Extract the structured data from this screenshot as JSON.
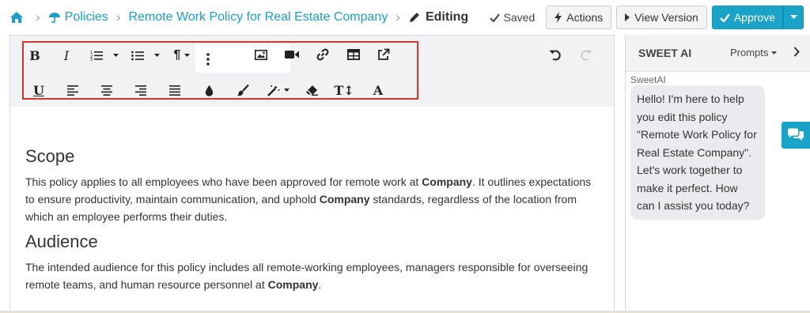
{
  "breadcrumb": {
    "home_icon": "home-icon",
    "policies_icon": "umbrella-icon",
    "policies_label": "Policies",
    "policy_title": "Remote Work Policy for Real Estate Company",
    "current_icon": "pencil-icon",
    "current_label": "Editing",
    "separator": "›"
  },
  "header": {
    "saved_label": "Saved",
    "actions_label": "Actions",
    "view_version_label": "View Version",
    "approve_label": "Approve"
  },
  "toolbar": {
    "buttons": [
      {
        "name": "bold",
        "label": "B"
      },
      {
        "name": "italic",
        "label": "I"
      },
      {
        "name": "ordered-list",
        "icon": "ordered-list-icon"
      },
      {
        "name": "unordered-list",
        "icon": "unordered-list-icon"
      },
      {
        "name": "paragraph",
        "label": "¶"
      },
      {
        "name": "more",
        "icon": "more-vertical-icon"
      },
      {
        "name": "image",
        "icon": "image-icon"
      },
      {
        "name": "video",
        "icon": "video-icon"
      },
      {
        "name": "link",
        "icon": "link-icon"
      },
      {
        "name": "table",
        "icon": "table-icon"
      },
      {
        "name": "external-link",
        "icon": "external-link-icon"
      },
      {
        "name": "undo",
        "icon": "undo-icon"
      },
      {
        "name": "redo",
        "icon": "redo-icon"
      },
      {
        "name": "underline",
        "label": "U"
      },
      {
        "name": "align-left",
        "icon": "align-left-icon"
      },
      {
        "name": "align-center",
        "icon": "align-center-icon"
      },
      {
        "name": "align-right",
        "icon": "align-right-icon"
      },
      {
        "name": "justify",
        "icon": "align-justify-icon"
      },
      {
        "name": "text-color",
        "icon": "droplet-icon"
      },
      {
        "name": "background-color",
        "icon": "brush-icon"
      },
      {
        "name": "magic",
        "icon": "magic-wand-icon"
      },
      {
        "name": "clear-format",
        "icon": "eraser-icon"
      },
      {
        "name": "font-size",
        "label": "T↕"
      },
      {
        "name": "font-family",
        "label": "A"
      }
    ]
  },
  "content": {
    "sections": [
      {
        "heading": "Scope",
        "text_parts": [
          "This policy applies to all employees who have been approved for remote work at ",
          "Company",
          ". It outlines expectations to ensure productivity, maintain communication, and uphold ",
          "Company",
          " standards, regardless of the location from which an employee performs their duties."
        ]
      },
      {
        "heading": "Audience",
        "text_parts": [
          "The intended audience for this policy includes all remote-working employees, managers responsible for overseeing remote teams, and human resource personnel at ",
          "Company",
          "."
        ]
      }
    ]
  },
  "sidepanel": {
    "title": "SWEET AI",
    "prompts_label": "Prompts",
    "sender": "SweetAI",
    "message": "Hello! I'm here to help you edit this policy \"Remote Work Policy for Real Estate Company\". Let's work together to make it perfect. How can I assist you today?"
  },
  "colors": {
    "link": "#1a9fc7",
    "approve": "#1aa3c8",
    "highlight_border": "#d9342b",
    "toolbar_bg": "#f1f2f3"
  }
}
